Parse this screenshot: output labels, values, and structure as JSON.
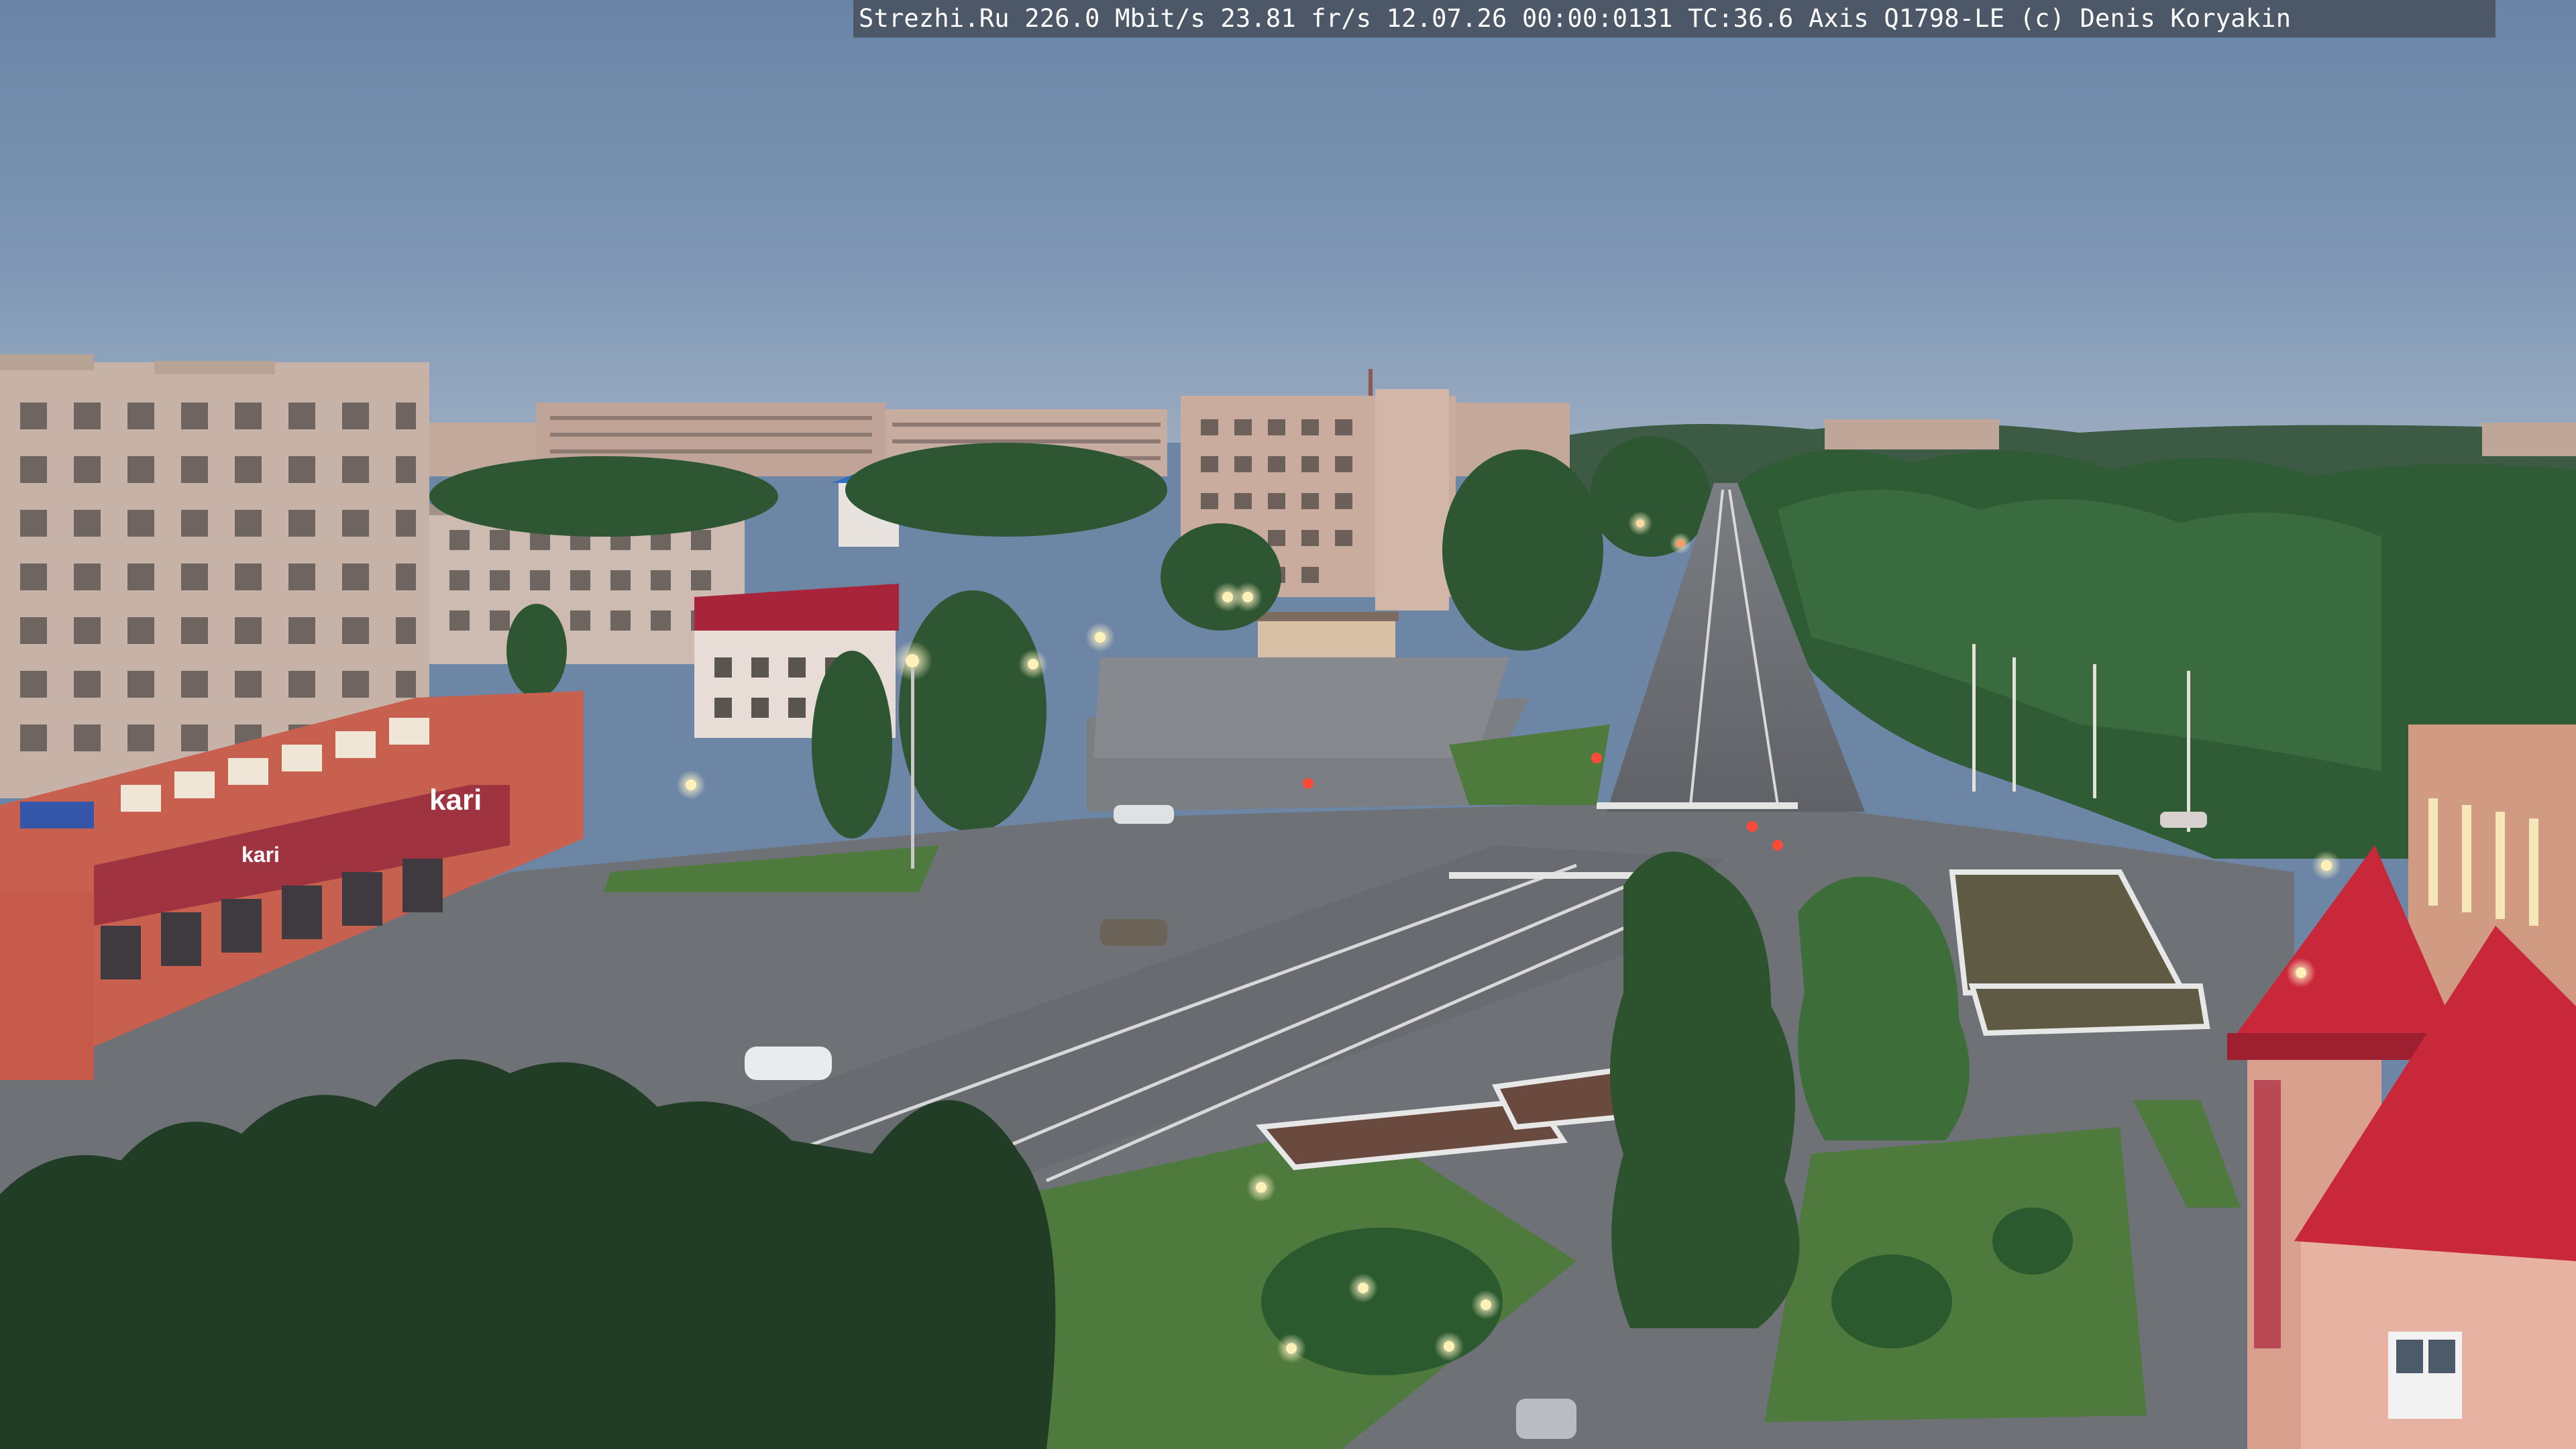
{
  "camera_overlay": {
    "text": "Strezhi.Ru 226.0 Mbit/s 23.81 fr/s 12.07.26 00:00:0131 TC:36.6  Axis Q1798-LE  (c) Denis Koryakin"
  },
  "storefront": {
    "brand": "kari",
    "brand_small": "kari"
  },
  "scene_colors": {
    "sky_top": "#6c85a6",
    "sky_horizon": "#9aa9bd",
    "trees": "#2f5a33",
    "road": "#6b6f75",
    "building_wall": "#c9b6ad",
    "red_roof": "#c8283a",
    "storefront_wall": "#c75a4a",
    "streetlight": "#ffe9a8"
  }
}
